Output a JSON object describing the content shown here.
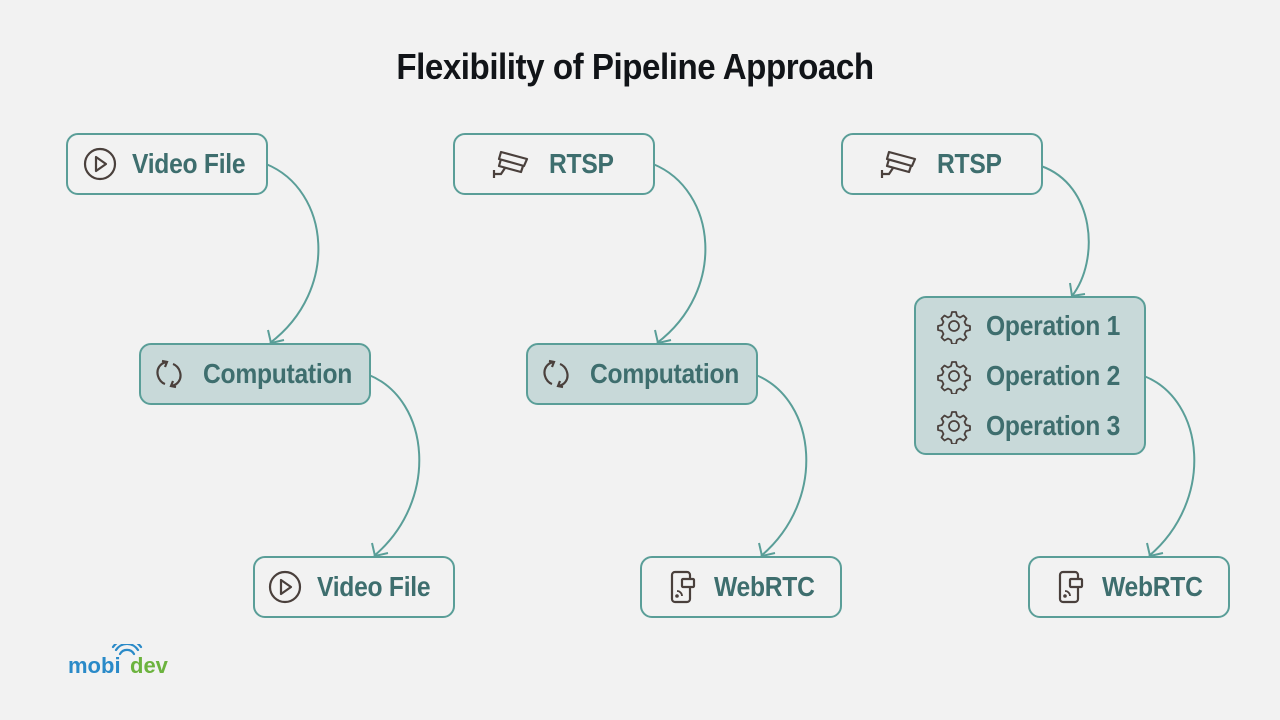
{
  "title": "Flexibility of Pipeline Approach",
  "pipelines": [
    {
      "source": {
        "label": "Video File",
        "icon": "play-circle-icon"
      },
      "process": {
        "labels": [
          "Computation"
        ],
        "icon": "refresh-icon"
      },
      "sink": {
        "label": "Video File",
        "icon": "play-circle-icon"
      }
    },
    {
      "source": {
        "label": "RTSP",
        "icon": "cctv-camera-icon"
      },
      "process": {
        "labels": [
          "Computation"
        ],
        "icon": "refresh-icon"
      },
      "sink": {
        "label": "WebRTC",
        "icon": "phone-stream-icon"
      }
    },
    {
      "source": {
        "label": "RTSP",
        "icon": "cctv-camera-icon"
      },
      "process": {
        "labels": [
          "Operation 1",
          "Operation 2",
          "Operation 3"
        ],
        "icon": "gear-icon"
      },
      "sink": {
        "label": "WebRTC",
        "icon": "phone-stream-icon"
      }
    }
  ],
  "logo": {
    "part1": "mobi",
    "part2": "dev",
    "color1": "#2a8ac8",
    "color2": "#6cb33e"
  },
  "colors": {
    "border": "#5a9e98",
    "text": "#3e6e6e",
    "fill": "#c8d9d9",
    "icon": "#4a403c"
  }
}
